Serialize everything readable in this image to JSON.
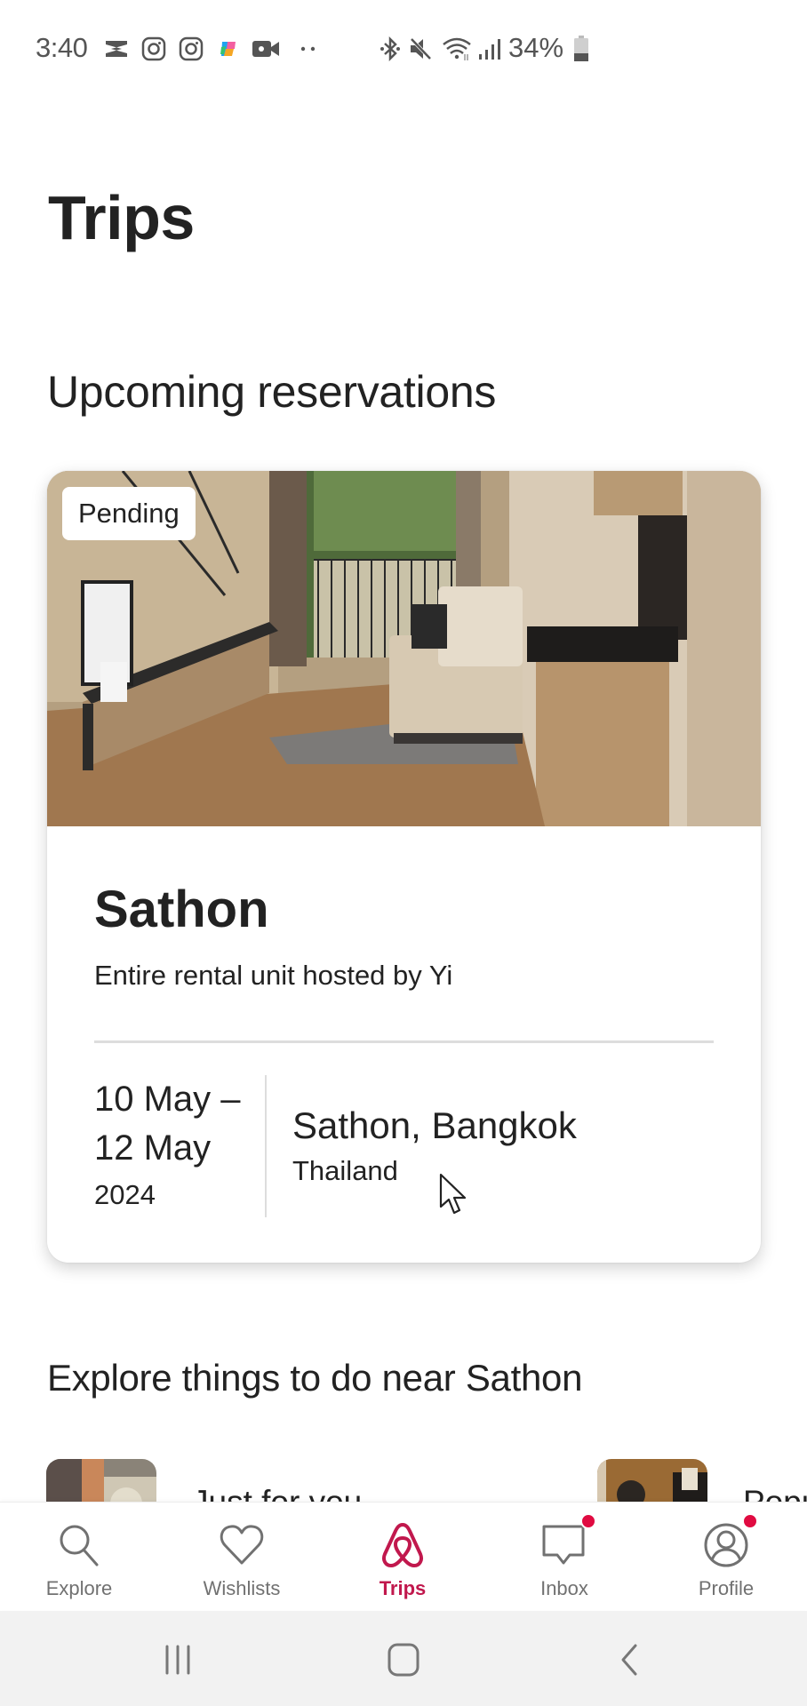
{
  "status_bar": {
    "time": "3:40",
    "left_icons": [
      "capcut-icon",
      "instagram-icon",
      "instagram-icon",
      "copilot-icon",
      "video-camera-icon",
      "more-dots-icon"
    ],
    "right_icons": [
      "bluetooth-icon",
      "mute-icon",
      "wifi-icon",
      "signal-icon"
    ],
    "battery_percent": "34%",
    "battery_level": 0.34
  },
  "page": {
    "title": "Trips"
  },
  "upcoming": {
    "heading": "Upcoming reservations",
    "reservation": {
      "status_badge": "Pending",
      "title": "Sathon",
      "subtitle": "Entire rental unit hosted by Yi",
      "date_start": "10 May –",
      "date_end": "12 May",
      "year": "2024",
      "location": "Sathon, Bangkok",
      "country": "Thailand"
    }
  },
  "explore": {
    "heading": "Explore things to do near Sathon",
    "items": [
      {
        "label": "Just for you"
      },
      {
        "label": "Popu"
      }
    ]
  },
  "bottom_nav": {
    "accent_color": "#c1184d",
    "items": [
      {
        "label": "Explore",
        "icon": "search-icon",
        "active": false,
        "notification": false
      },
      {
        "label": "Wishlists",
        "icon": "heart-icon",
        "active": false,
        "notification": false
      },
      {
        "label": "Trips",
        "icon": "airbnb-logo-icon",
        "active": true,
        "notification": false
      },
      {
        "label": "Inbox",
        "icon": "message-icon",
        "active": false,
        "notification": true
      },
      {
        "label": "Profile",
        "icon": "profile-icon",
        "active": false,
        "notification": true
      }
    ]
  },
  "system_nav": {
    "buttons": [
      "recent-apps",
      "home",
      "back"
    ]
  }
}
